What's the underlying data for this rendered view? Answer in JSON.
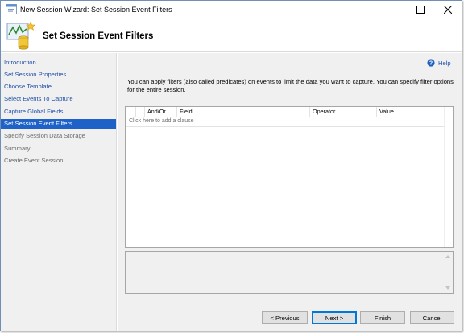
{
  "window": {
    "title": "New Session Wizard: Set Session Event Filters",
    "controls": {
      "minimize": "minimize-icon",
      "maximize": "maximize-icon",
      "close": "close-icon"
    }
  },
  "header": {
    "title": "Set Session Event Filters",
    "icon": "wizard-chart-icon"
  },
  "sidebar": {
    "items": [
      {
        "label": "Introduction",
        "state": "link"
      },
      {
        "label": "Set Session Properties",
        "state": "link"
      },
      {
        "label": "Choose Template",
        "state": "link"
      },
      {
        "label": "Select Events To Capture",
        "state": "link"
      },
      {
        "label": "Capture Global Fields",
        "state": "link"
      },
      {
        "label": "Set Session Event Filters",
        "state": "active"
      },
      {
        "label": "Specify Session Data Storage",
        "state": "disabled"
      },
      {
        "label": "Summary",
        "state": "disabled"
      },
      {
        "label": "Create Event Session",
        "state": "disabled"
      }
    ]
  },
  "help": {
    "label": "Help",
    "icon": "help-icon"
  },
  "intro_text": "You can apply filters (also called predicates) on events to limit the data you want to capture. You can specify filter options for the entire session.",
  "filter_grid": {
    "columns": [
      "And/Or",
      "Field",
      "Operator",
      "Value"
    ],
    "add_row_text": "Click here to add a clause"
  },
  "buttons": {
    "previous": "< Previous",
    "next": "Next >",
    "finish": "Finish",
    "cancel": "Cancel"
  },
  "colors": {
    "active_nav_bg": "#1e62c8",
    "link": "#2050a8",
    "disabled_text": "#6d6d6d",
    "panel_bg": "#f0f0f0"
  }
}
